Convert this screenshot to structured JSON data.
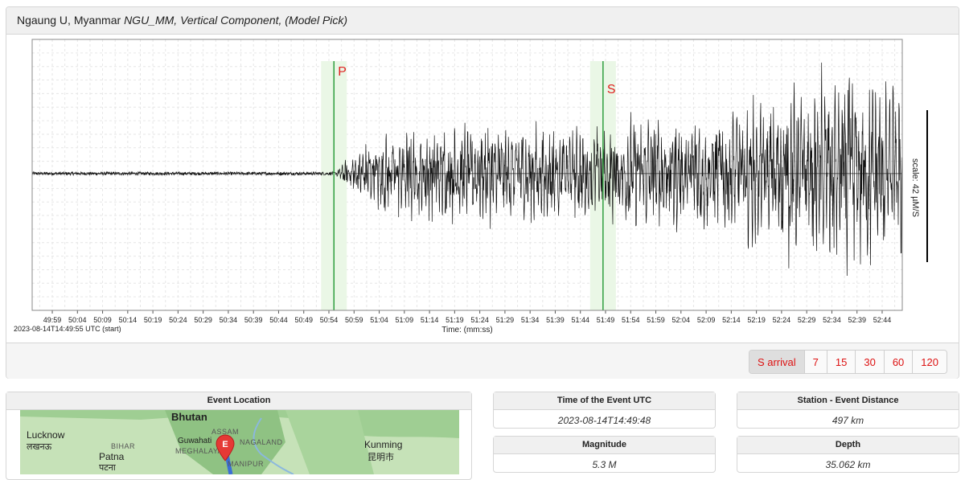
{
  "panel": {
    "station": "Ngaung U, Myanmar",
    "title_detail": "NGU_MM, Vertical Component, (Model Pick)"
  },
  "chart_data": {
    "type": "line",
    "title": "Ngaung U, Myanmar NGU_MM, Vertical Component, (Model Pick)",
    "xlabel": "Time: (mm:ss)",
    "start_label": "2023-08-14T14:49:55 UTC (start)",
    "scale_label": "scale: 42 µM/S",
    "x_ticks": [
      "49:59",
      "50:04",
      "50:09",
      "50:14",
      "50:19",
      "50:24",
      "50:29",
      "50:34",
      "50:39",
      "50:44",
      "50:49",
      "50:54",
      "50:59",
      "51:04",
      "51:09",
      "51:14",
      "51:19",
      "51:24",
      "51:29",
      "51:34",
      "51:39",
      "51:44",
      "51:49",
      "51:54",
      "51:59",
      "52:04",
      "52:09",
      "52:14",
      "52:19",
      "52:24",
      "52:29",
      "52:34",
      "52:39",
      "52:44"
    ],
    "xlim_seconds": [
      0,
      173
    ],
    "ylim": [
      -1,
      1
    ],
    "grid": true,
    "picks": [
      {
        "label": "P",
        "time_s": 60.0
      },
      {
        "label": "S",
        "time_s": 113.5
      }
    ],
    "waveform": [
      {
        "t": 0,
        "amp": 0.0
      },
      {
        "t": 60.0,
        "amp": 0.0
      },
      {
        "t": 62.0,
        "amp": 0.12
      },
      {
        "t": 70,
        "amp": 0.45
      },
      {
        "t": 90,
        "amp": 0.5
      },
      {
        "t": 110,
        "amp": 0.5
      },
      {
        "t": 130,
        "amp": 0.6
      },
      {
        "t": 150,
        "amp": 0.8
      },
      {
        "t": 163,
        "amp": 1.0
      },
      {
        "t": 173,
        "amp": 0.8
      }
    ]
  },
  "buttons": [
    "S arrival",
    "7",
    "15",
    "30",
    "60",
    "120"
  ],
  "event_location": {
    "heading": "Event Location"
  },
  "map_labels": {
    "bhutan": "Bhutan",
    "lucknow": "Lucknow",
    "lucknow_local": "लखनऊ",
    "bihar": "BIHAR",
    "patna": "Patna",
    "patna_local": "पटना",
    "assam": "ASSAM",
    "meghalaya": "MEGHALAYA",
    "guwahati": "Guwahati",
    "nagaland": "NAGALAND",
    "manipur": "MANIPUR",
    "kunming": "Kunming",
    "kunming_local": "昆明市",
    "marker": "E"
  },
  "time_event": {
    "heading": "Time of the Event UTC",
    "value": "2023-08-14T14:49:48"
  },
  "distance": {
    "heading": "Station - Event Distance",
    "value": "497 km"
  },
  "magnitude": {
    "heading": "Magnitude",
    "value": "5.3 M"
  },
  "depth": {
    "heading": "Depth",
    "value": "35.062 km"
  }
}
